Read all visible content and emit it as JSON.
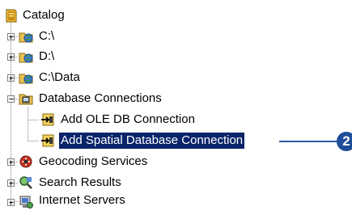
{
  "tree": {
    "root": {
      "label": "Catalog",
      "icon": "catalog-icon"
    },
    "items": [
      {
        "label": "C:\\",
        "icon": "drive-folder-icon",
        "expander": "plus"
      },
      {
        "label": "D:\\",
        "icon": "drive-folder-icon",
        "expander": "plus"
      },
      {
        "label": "C:\\Data",
        "icon": "folder-connection-icon",
        "expander": "plus"
      },
      {
        "label": "Database Connections",
        "icon": "database-connections-icon",
        "expander": "minus",
        "children": [
          {
            "label": "Add OLE DB Connection",
            "icon": "add-connection-icon"
          },
          {
            "label": "Add Spatial Database Connection",
            "icon": "add-connection-icon",
            "selected": true
          }
        ]
      },
      {
        "label": "Geocoding Services",
        "icon": "geocoding-icon",
        "expander": "plus"
      },
      {
        "label": "Search Results",
        "icon": "search-results-icon",
        "expander": "plus"
      },
      {
        "label": "Internet Servers",
        "icon": "internet-servers-icon",
        "expander": "plus"
      }
    ]
  },
  "callout": {
    "number": "2"
  },
  "colors": {
    "selection_bg": "#0a246a",
    "selection_text": "#ffffff",
    "callout": "#1f4d9a"
  }
}
